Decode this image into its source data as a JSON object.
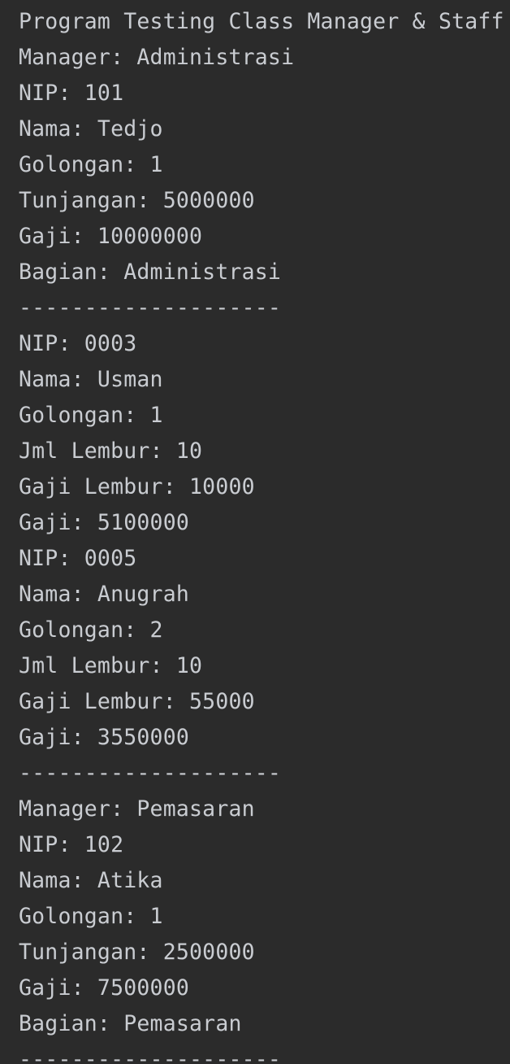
{
  "console": {
    "lines": [
      "Program Testing Class Manager & Staff",
      "Manager: Administrasi",
      "NIP: 101",
      "Nama: Tedjo",
      "Golongan: 1",
      "Tunjangan: 5000000",
      "Gaji: 10000000",
      "Bagian: Administrasi",
      "--------------------",
      "NIP: 0003",
      "Nama: Usman",
      "Golongan: 1",
      "Jml Lembur: 10",
      "Gaji Lembur: 10000",
      "Gaji: 5100000",
      "NIP: 0005",
      "Nama: Anugrah",
      "Golongan: 2",
      "Jml Lembur: 10",
      "Gaji Lembur: 55000",
      "Gaji: 3550000",
      "--------------------",
      "Manager: Pemasaran",
      "NIP: 102",
      "Nama: Atika",
      "Golongan: 1",
      "Tunjangan: 2500000",
      "Gaji: 7500000",
      "Bagian: Pemasaran",
      "--------------------"
    ]
  },
  "colors": {
    "background": "#2b2b2b",
    "text": "#c9ccd1"
  }
}
